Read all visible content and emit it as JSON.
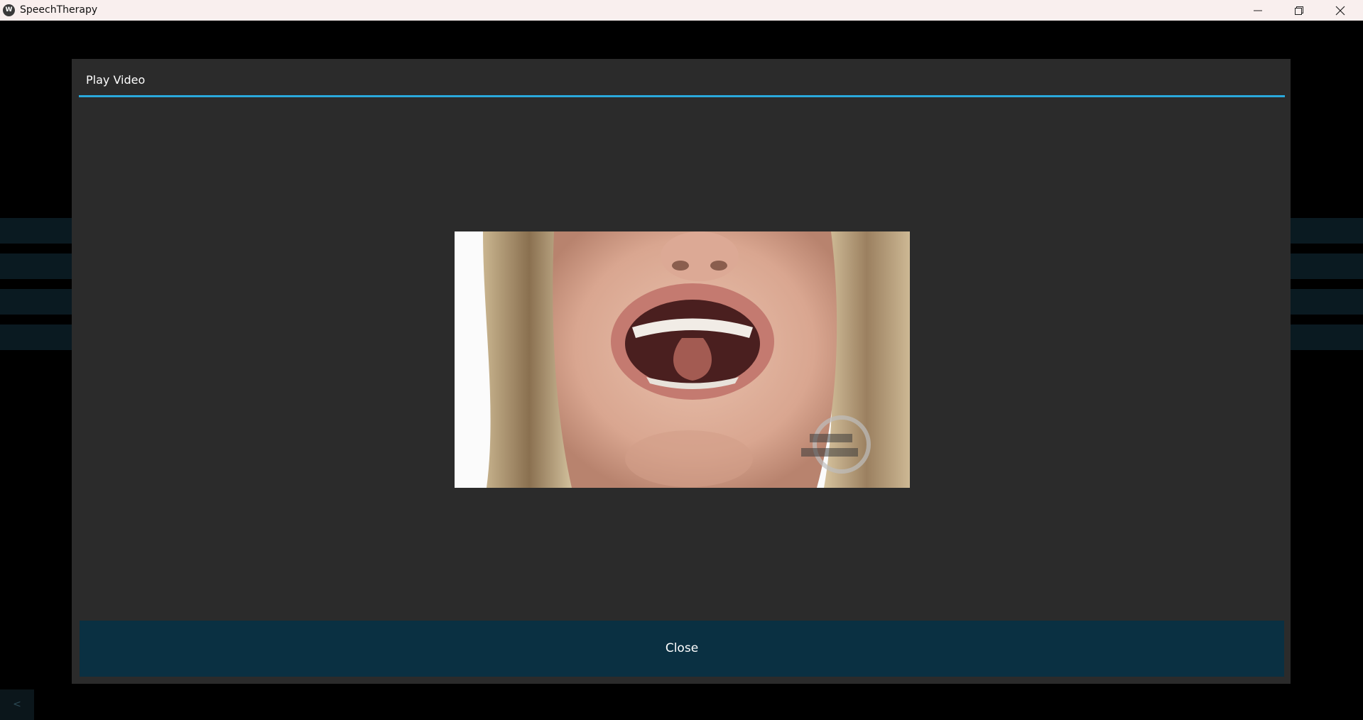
{
  "window": {
    "title": "SpeechTherapy",
    "icon": "app-logo-icon",
    "controls": [
      "minimize-icon",
      "restore-icon",
      "close-icon"
    ]
  },
  "dialog": {
    "title": "Play Video",
    "close_label": "Close",
    "accent_color": "#2aa9dc",
    "button_color": "#0a3042"
  },
  "video": {
    "content": "video-frame"
  },
  "nav": {
    "back_label": "<"
  }
}
